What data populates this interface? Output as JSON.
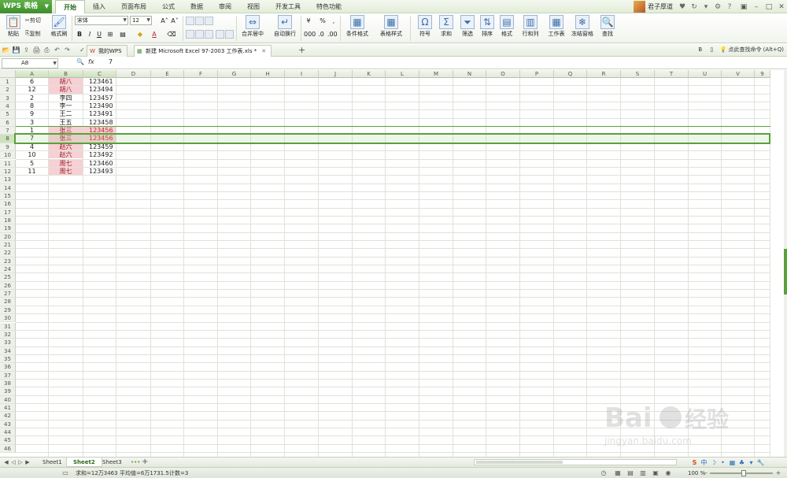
{
  "menubar": {
    "app_name": "WPS 表格",
    "tabs": [
      "开始",
      "插入",
      "页面布局",
      "公式",
      "数据",
      "审阅",
      "视图",
      "开发工具",
      "特色功能"
    ],
    "active_tab": "开始",
    "username": "君子厚道"
  },
  "ribbon": {
    "paste": "粘贴",
    "cut": "剪切",
    "copy": "复制",
    "format_painter": "格式刷",
    "font_name": "宋体",
    "font_size": "12",
    "bold": "B",
    "italic": "I",
    "underline": "U",
    "merge_center": "合并居中",
    "wrap_text": "自动换行",
    "percent": "%",
    "conditional_format": "条件格式",
    "table_style": "表格样式",
    "symbol": "符号",
    "sum": "求和",
    "filter": "筛选",
    "sort": "排序",
    "format": "格式",
    "row_col": "行和列",
    "worksheet": "工作表",
    "freeze": "冻结窗格",
    "find": "查找"
  },
  "docbar": {
    "tabs": [
      {
        "label": "我的WPS",
        "active": false
      },
      {
        "label": "新建 Microsoft Excel 97-2003 工作表.xls *",
        "active": true
      }
    ],
    "search_cmd": "点此查找命令 (Alt+Q)"
  },
  "formula_bar": {
    "cell_ref": "A8",
    "fx": "fx",
    "value": "7"
  },
  "columns": [
    "A",
    "B",
    "C",
    "D",
    "E",
    "F",
    "G",
    "H",
    "I",
    "J",
    "K",
    "L",
    "M",
    "N",
    "O",
    "P",
    "Q",
    "R",
    "S",
    "T",
    "U",
    "V",
    "9"
  ],
  "rows": [
    [
      "6",
      "胡八",
      "123461"
    ],
    [
      "12",
      "胡八",
      "123494"
    ],
    [
      "2",
      "李四",
      "123457"
    ],
    [
      "8",
      "李一",
      "123490"
    ],
    [
      "9",
      "王二",
      "123491"
    ],
    [
      "3",
      "王五",
      "123458"
    ],
    [
      "1",
      "张三",
      "123456"
    ],
    [
      "7",
      "张三",
      "123456"
    ],
    [
      "4",
      "赵六",
      "123459"
    ],
    [
      "10",
      "赵六",
      "123492"
    ],
    [
      "5",
      "周七",
      "123460"
    ],
    [
      "11",
      "周七",
      "123493"
    ]
  ],
  "highlight": {
    "b_rows": [
      1,
      2,
      7,
      8,
      9,
      10,
      11,
      12
    ],
    "c_rows": [
      7,
      8
    ],
    "color": "#f6d0d4"
  },
  "selected_row": 8,
  "row_count": 46,
  "sheets": [
    {
      "label": "Sheet1",
      "active": false
    },
    {
      "label": "Sheet2",
      "active": true
    },
    {
      "label": "Sheet3",
      "active": false
    }
  ],
  "sheet_more": "•••",
  "status": {
    "sum": "求和=12万3463",
    "average": "平均值=6万1731.5",
    "count": "计数=3",
    "zoom": "100 %"
  },
  "colors": {
    "accent": "#5aa03c",
    "app_button": "#3e8f2b"
  }
}
